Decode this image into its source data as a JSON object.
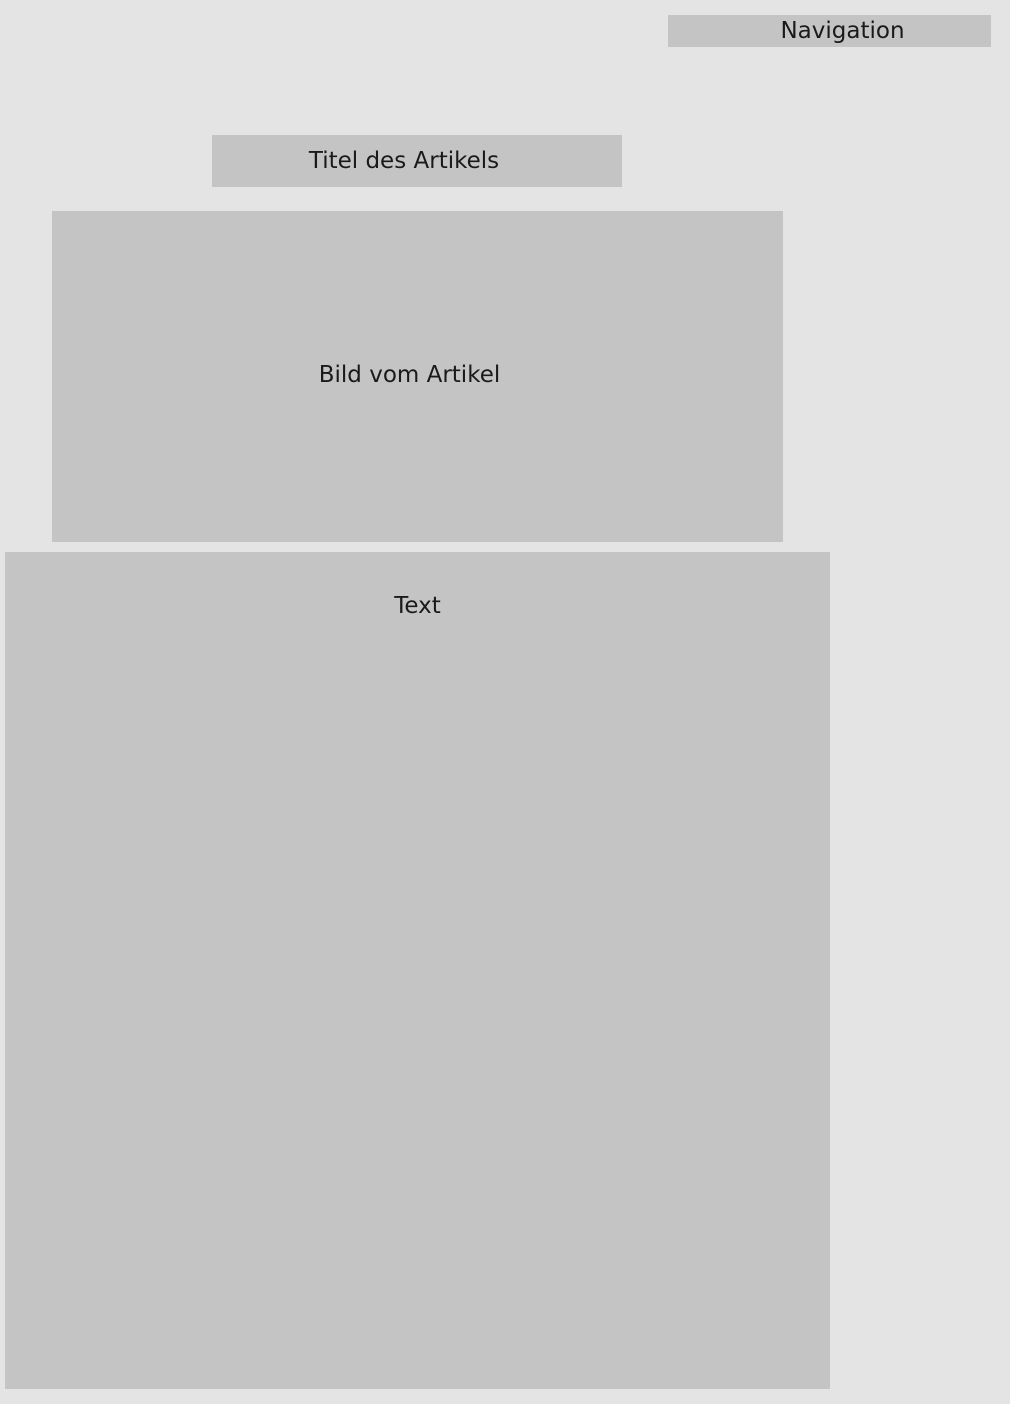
{
  "navigation": {
    "label": "Navigation"
  },
  "article": {
    "title_label": "Titel des Artikels",
    "image_label": "Bild vom Artikel",
    "text_label": "Text"
  },
  "colors": {
    "background": "#e4e4e4",
    "placeholder_box": "#c4c4c4",
    "text": "#1a1a1a"
  }
}
